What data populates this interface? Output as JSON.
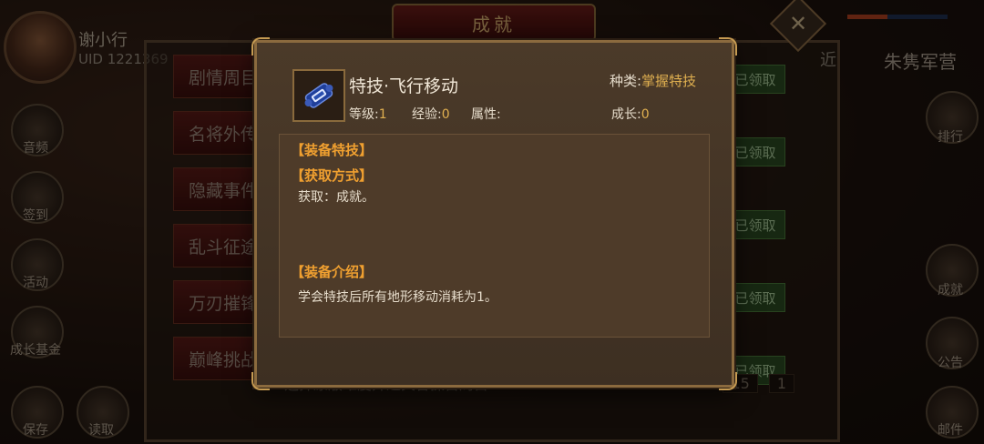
{
  "background": {
    "player": {
      "name": "谢小行",
      "uid": "UID  1221369"
    },
    "title": "成就",
    "close_icon": "close-icon",
    "left_tabs": [
      "剧情周目",
      "名将外传",
      "隐藏事件",
      "乱斗征途",
      "万刃摧锋",
      "巅峰挑战"
    ],
    "claim_label": "已领取",
    "top_right": {
      "label_a": "近",
      "label_b": "朱隽军营"
    },
    "left_icons": [
      "音频",
      "签到",
      "活动",
      "成长基金"
    ],
    "right_icons": [
      "排行",
      "成就",
      "公告"
    ],
    "bottom_icons": [
      "保存",
      "读取",
      "邮件"
    ],
    "bottom_task": {
      "text": "选择原版难度并通关曹操首周目",
      "progress_a": "15",
      "progress_b": "1"
    }
  },
  "modal": {
    "skill_icon": "scroll-icon",
    "name": "特技·飞行移动",
    "type_label": "种类:",
    "type_value": "掌握特技",
    "stats": {
      "level_label": "等级:",
      "level_value": "1",
      "exp_label": "经验:",
      "exp_value": "0",
      "attr_label": "属性:",
      "growth_label": "成长:",
      "growth_value": "0"
    },
    "sections": {
      "equip_skill": "【装备特技】",
      "acquire_title": "【获取方式】",
      "acquire_text": "获取：成就。",
      "intro_title": "【装备介绍】",
      "intro_text": "学会特技后所有地形移动消耗为1。"
    }
  },
  "colors": {
    "accent_gold": "#e0b050",
    "section_orange": "#f0a030",
    "frame_brown": "#8b6a3e"
  }
}
